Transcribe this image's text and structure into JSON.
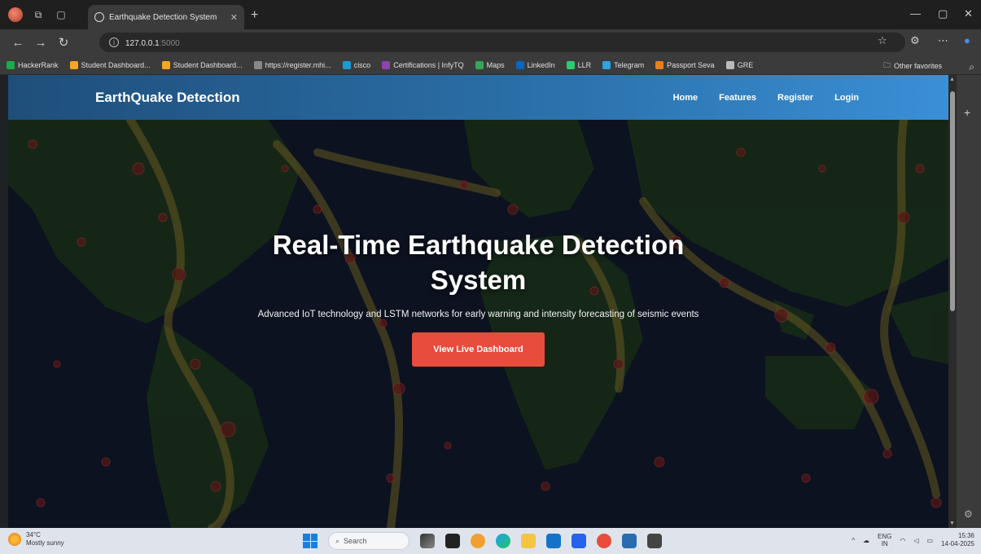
{
  "browser": {
    "tab_title": "Earthquake Detection System",
    "url_host": "127.0.0.1",
    "url_port": ":5000",
    "bookmarks": [
      {
        "label": "HackerRank",
        "color": "#1ba94c"
      },
      {
        "label": "Student Dashboard...",
        "color": "#f5a623"
      },
      {
        "label": "Student Dashboard...",
        "color": "#f5a623"
      },
      {
        "label": "https://register.mhi...",
        "color": "#888888"
      },
      {
        "label": "cisco",
        "color": "#1b9ad6"
      },
      {
        "label": "Certifications | InfyTQ",
        "color": "#8e44ad"
      },
      {
        "label": "Maps",
        "color": "#34a853"
      },
      {
        "label": "LinkedIn",
        "color": "#0a66c2"
      },
      {
        "label": "LLR",
        "color": "#2ecc71"
      },
      {
        "label": "Telegram",
        "color": "#2aa3e0"
      },
      {
        "label": "Passport Seva",
        "color": "#e67e22"
      },
      {
        "label": "GRE",
        "color": "#bbbbbb"
      }
    ],
    "other_favorites": "Other favorites"
  },
  "site": {
    "brand": "EarthQuake Detection",
    "nav": [
      "Home",
      "Features",
      "Register",
      "Login"
    ],
    "hero_title": "Real-Time Earthquake Detection System",
    "hero_subtitle": "Advanced IoT technology and LSTM networks for early warning and intensity forecasting of seismic events",
    "cta_label": "View Live Dashboard"
  },
  "taskbar": {
    "temperature": "34°C",
    "weather": "Mostly sunny",
    "search_placeholder": "Search",
    "lang_top": "ENG",
    "lang_bottom": "IN",
    "time": "15:36",
    "date": "14-04-2025"
  },
  "colors": {
    "nav_gradient_start": "#1f4e7a",
    "nav_gradient_end": "#3a8fd6",
    "cta": "#e74c3c"
  }
}
